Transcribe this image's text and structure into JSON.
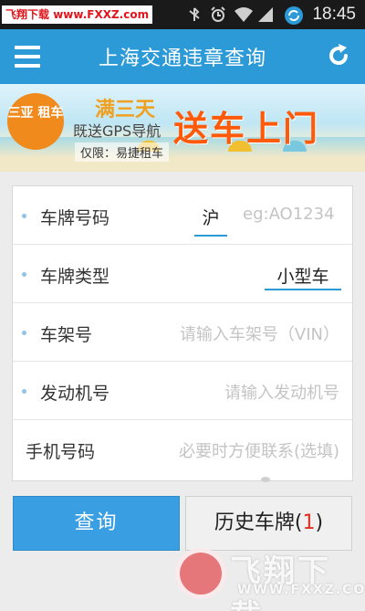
{
  "status_bar": {
    "watermark_site": "飞翔下载",
    "watermark_url": "www.FXXZ.com",
    "time": "18:45",
    "icons": [
      "no-signal-icon",
      "alarm-icon",
      "wifi-icon",
      "cell-signal-icon",
      "sync-icon"
    ]
  },
  "header": {
    "title": "上海交通违章查询",
    "menu_icon": "hamburger-menu-icon",
    "refresh_icon": "refresh-icon",
    "background": "#2d9ad8"
  },
  "banner": {
    "badge": "三亚 租车",
    "headline_small": "满三天",
    "headline_sub": "既送GPS导航",
    "headline_big": "送车上门",
    "footnote": "仅限：易捷租车"
  },
  "form": {
    "plate": {
      "label": "车牌号码",
      "province": "沪",
      "placeholder": "eg:AO1234"
    },
    "type": {
      "label": "车牌类型",
      "value": "小型车"
    },
    "frame": {
      "label": "车架号",
      "placeholder": "请输入车架号（VIN）"
    },
    "engine": {
      "label": "发动机号",
      "placeholder": "请输入发动机号"
    },
    "phone": {
      "label": "手机号码",
      "placeholder": "必要时方便联系(选填)"
    }
  },
  "buttons": {
    "query_label": "查询",
    "history_label": "历史车牌(",
    "history_count": "1",
    "history_suffix": ")"
  },
  "watermark_bottom": {
    "text": "飞翔下载",
    "url": "WWW.FXXZ.COM"
  }
}
